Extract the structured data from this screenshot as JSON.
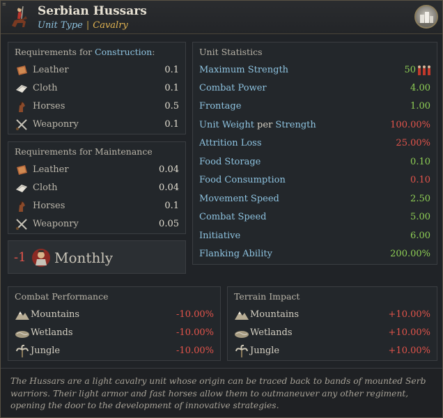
{
  "header": {
    "corner_mark": "≡",
    "title": "Serbian Hussars",
    "type_key": "Unit Type",
    "type_sep": "|",
    "type_value": "Cavalry",
    "emblem_icon": "hussar-rider-icon",
    "portrait_icon": "castle-portrait-icon"
  },
  "construction": {
    "title_prefix": "Requirements for ",
    "title_highlight": "Construction",
    "title_suffix": ":",
    "items": [
      {
        "icon": "leather-icon",
        "label": "Leather",
        "value": "0.1"
      },
      {
        "icon": "cloth-icon",
        "label": "Cloth",
        "value": "0.1"
      },
      {
        "icon": "horses-icon",
        "label": "Horses",
        "value": "0.5"
      },
      {
        "icon": "weaponry-icon",
        "label": "Weaponry",
        "value": "0.1"
      }
    ]
  },
  "maintenance": {
    "title": "Requirements for Maintenance",
    "items": [
      {
        "icon": "leather-icon",
        "label": "Leather",
        "value": "0.04"
      },
      {
        "icon": "cloth-icon",
        "label": "Cloth",
        "value": "0.04"
      },
      {
        "icon": "horses-icon",
        "label": "Horses",
        "value": "0.1"
      },
      {
        "icon": "weaponry-icon",
        "label": "Weaponry",
        "value": "0.05"
      }
    ]
  },
  "monthly": {
    "amount": "-1",
    "icon": "soldier-upkeep-icon",
    "label": "Monthly"
  },
  "stats": {
    "title": "Unit Statistics",
    "rows": [
      {
        "label": "Maximum Strength",
        "value": "50",
        "color": "green",
        "icon": "soldiers-icon"
      },
      {
        "label": "Combat Power",
        "value": "4.00",
        "color": "green"
      },
      {
        "label": "Frontage",
        "value": "1.00",
        "color": "green"
      },
      {
        "label": "Unit Weight",
        "label_mid": " per ",
        "label_end": "Strength",
        "value": "100.00%",
        "color": "red"
      },
      {
        "label": "Attrition Loss",
        "value": "25.00%",
        "color": "red"
      },
      {
        "label": "Food Storage",
        "value": "0.10",
        "color": "green"
      },
      {
        "label": "Food Consumption",
        "value": "0.10",
        "color": "red"
      },
      {
        "label": "Movement Speed",
        "value": "2.50",
        "color": "green"
      },
      {
        "label": "Combat Speed",
        "value": "5.00",
        "color": "green"
      },
      {
        "label": "Initiative",
        "value": "6.00",
        "color": "green"
      },
      {
        "label": "Flanking Ability",
        "value": "200.00%",
        "color": "green"
      }
    ]
  },
  "combat_performance": {
    "title": "Combat Performance",
    "rows": [
      {
        "icon": "mountains-icon",
        "label": "Mountains",
        "value": "-10.00%"
      },
      {
        "icon": "wetlands-icon",
        "label": "Wetlands",
        "value": "-10.00%"
      },
      {
        "icon": "jungle-icon",
        "label": "Jungle",
        "value": "-10.00%"
      }
    ]
  },
  "terrain_impact": {
    "title": "Terrain Impact",
    "rows": [
      {
        "icon": "mountains-icon",
        "label": "Mountains",
        "value": "+10.00%"
      },
      {
        "icon": "wetlands-icon",
        "label": "Wetlands",
        "value": "+10.00%"
      },
      {
        "icon": "jungle-icon",
        "label": "Jungle",
        "value": "+10.00%"
      }
    ]
  },
  "description": "The Hussars are a light cavalry unit whose origin can be traced back to bands of mounted Serb warriors. Their light armor and fast horses allow them to outmaneuver any other regiment, opening the door to the development of innovative strategies.",
  "colors": {
    "accent_blue": "#8ec3e0",
    "accent_gold": "#e3b552",
    "positive": "#8fcf55",
    "negative": "#e4544b"
  }
}
